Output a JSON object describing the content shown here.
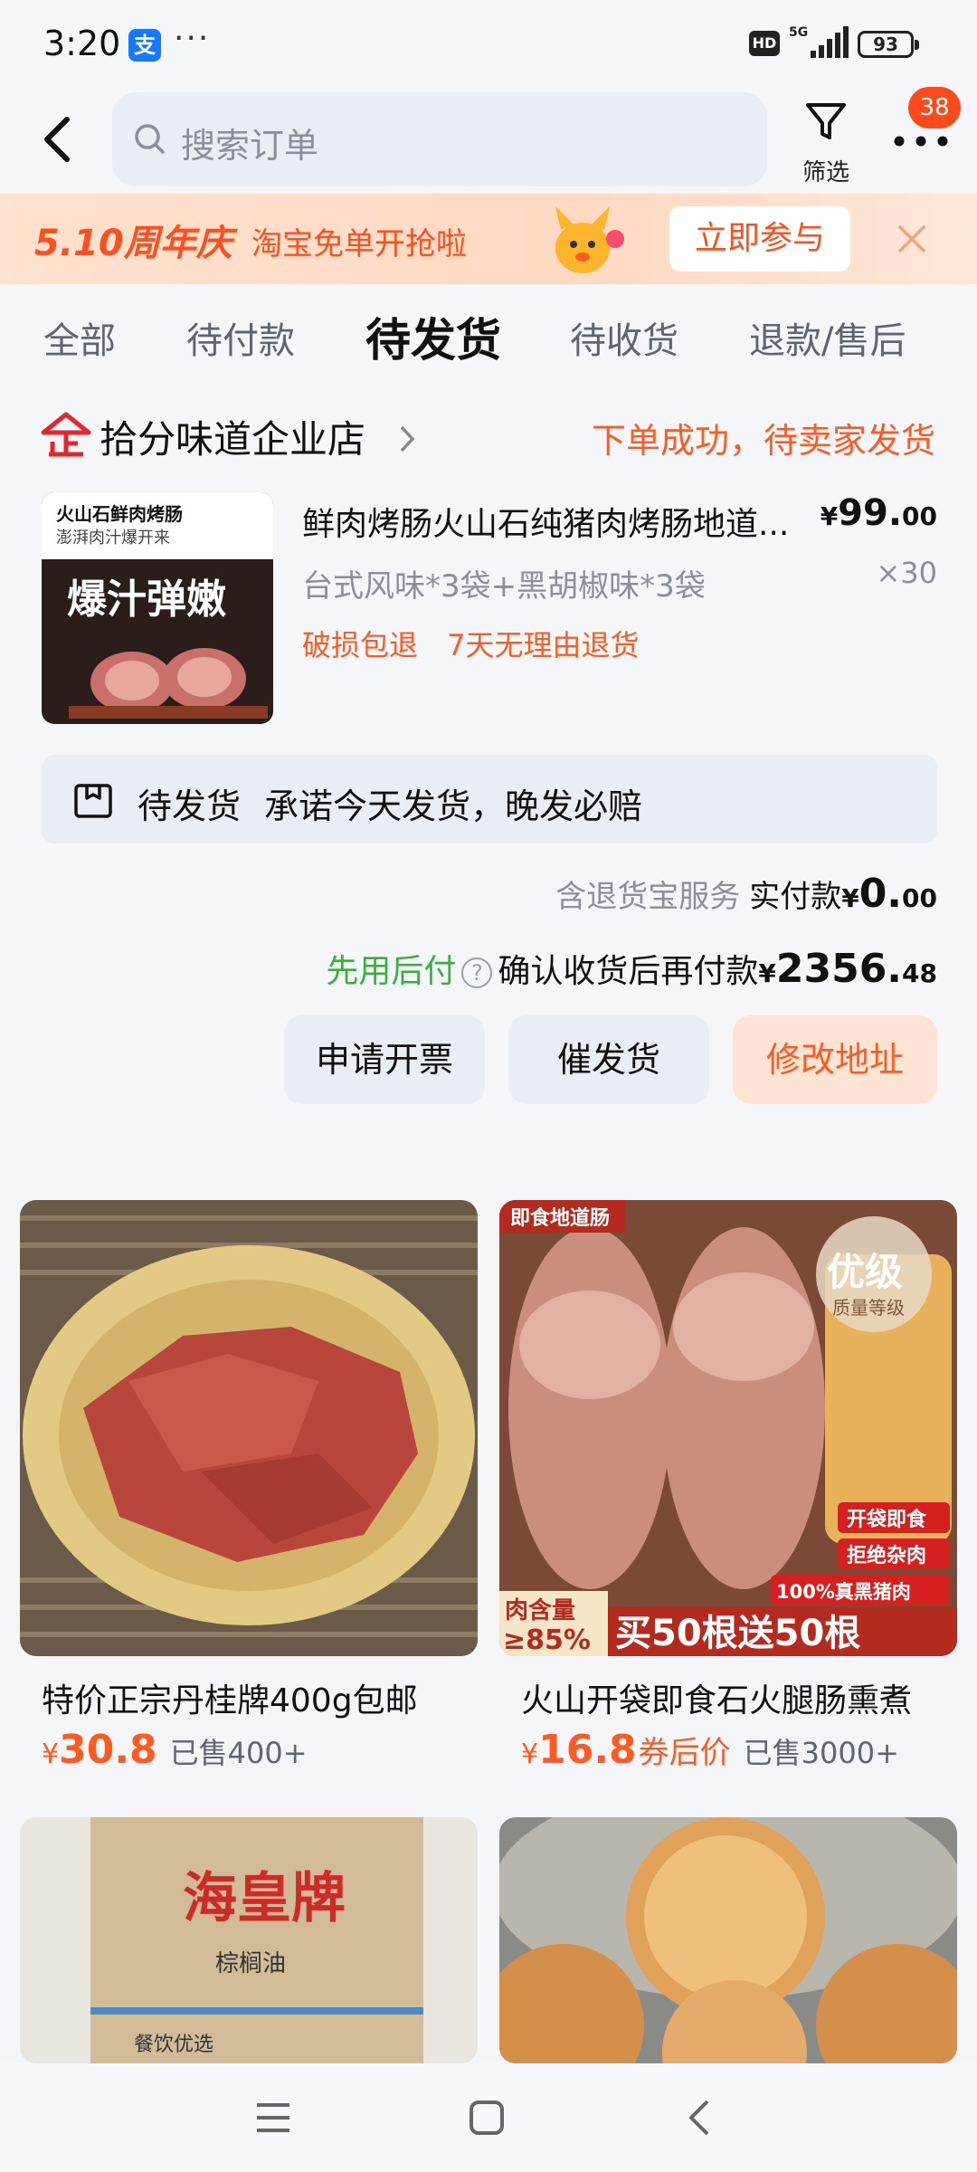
{
  "status_bar": {
    "time": "3:20",
    "battery": "93",
    "network": "5G"
  },
  "header": {
    "search_placeholder": "搜索订单",
    "filter_label": "筛选",
    "message_badge": "38"
  },
  "promo": {
    "logo": "5.10周年庆",
    "text": "淘宝免单开抢啦",
    "join_label": "立即参与"
  },
  "tabs": [
    {
      "label": "全部"
    },
    {
      "label": "待付款"
    },
    {
      "label": "待发货",
      "active": true
    },
    {
      "label": "待收货"
    },
    {
      "label": "退款/售后"
    }
  ],
  "order": {
    "shop_name": "拾分味道企业店",
    "order_status": "下单成功，待卖家发货",
    "thumb_line1": "火山石鲜肉烤肠",
    "thumb_line2": "澎湃肉汁爆开来",
    "thumb_big": "爆汁弹嫩",
    "product_title": "鲜肉烤肠火山石纯猪肉烤肠地道...",
    "price_yen": "¥",
    "price_int": "99.",
    "price_dec": "00",
    "quantity": "×30",
    "spec": "台式风味*3袋+黑胡椒味*3袋",
    "guarantees": [
      "破损包退",
      "7天无理由退货"
    ],
    "notice_status": "待发货",
    "notice_text": "承诺今天发货，晚发必赔",
    "service_text": "含退货宝服务",
    "paid_label": "实付款",
    "paid_yen": "¥",
    "paid_int": "0.",
    "paid_dec": "00",
    "later_label": "先用后付",
    "later_text": "确认收货后再付款",
    "later_yen": "¥",
    "later_int": "2356.",
    "later_dec": "48",
    "buttons": [
      "申请开票",
      "催发货",
      "修改地址"
    ]
  },
  "recommendations": [
    {
      "name": "特价正宗丹桂牌400g包邮",
      "price_yen": "¥",
      "price": "30.8",
      "sold": "已售400+"
    },
    {
      "name": "火山开袋即食石火腿肠熏煮",
      "price_yen": "¥",
      "price": "16.8",
      "coupon": "券后价",
      "sold": "已售3000+",
      "img_tag": "即食地道肠",
      "img_grade": "优级",
      "img_grade_sub": "质量等级",
      "img_meat": "肉含量",
      "img_meat_pct": "≥85%",
      "img_promo": "买50根送50根",
      "img_side": [
        "开袋即食",
        "拒绝杂肉",
        "100%真黑猪肉"
      ]
    },
    {
      "img_brand": "海皇牌",
      "img_sub": "棕榈油",
      "img_sub2": "餐饮优选"
    },
    {}
  ]
}
